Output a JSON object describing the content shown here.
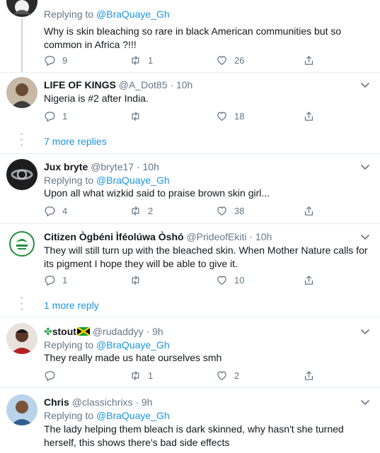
{
  "tweets": [
    {
      "name": "",
      "handle": "",
      "time": "",
      "replying_prefix": "Replying to",
      "replying_to": "@BraQuaye_Gh",
      "text": "Why is skin bleaching so rare in black American communities but so common in Africa ?!!!",
      "replies": "9",
      "retweets": "1",
      "likes": "26"
    },
    {
      "name": "LIFE OF KINGS",
      "handle": "@A_Dot85",
      "time": "10h",
      "text": "Nigeria is #2 after India.",
      "replies": "1",
      "retweets": "",
      "likes": "18"
    },
    {
      "name": "Jux bryte",
      "handle": "@bryte17",
      "time": "10h",
      "replying_prefix": "Replying to",
      "replying_to": "@BraQuaye_Gh",
      "text": "Upon all what wizkid said to praise brown skin girl...",
      "replies": "4",
      "retweets": "2",
      "likes": "38"
    },
    {
      "name": "Citizen Ògbéni Ìféolúwa Òshó",
      "handle": "@PrideofEkiti",
      "time": "10h",
      "text": "They will still turn up with the bleached skin. When Mother Nature calls for its pigment I hope they will be able to give it.",
      "replies": "1",
      "retweets": "",
      "likes": "10"
    },
    {
      "name_prefix": "✤",
      "name": "stout",
      "handle": "@rudaddyy",
      "time": "9h",
      "replying_prefix": "Replying to",
      "replying_to": "@BraQuaye_Gh",
      "text": "They really made us hate ourselves smh",
      "replies": "",
      "retweets": "1",
      "likes": "2"
    },
    {
      "name": "Chris",
      "handle": "@classichrixs",
      "time": "9h",
      "replying_prefix": "Replying to",
      "replying_to": "@BraQuaye_Gh",
      "text": "The lady helping them bleach is dark skinned, why hasn't she turned herself, this shows there's bad side effects"
    }
  ],
  "more_replies_1": "7 more replies",
  "more_replies_2": "1 more reply",
  "separator_dot": "·",
  "icons": {
    "reply": "reply-icon",
    "retweet": "retweet-icon",
    "like": "heart-icon",
    "share": "share-icon",
    "menu": "chevron-down-icon"
  },
  "colors": {
    "link": "#1b95e0",
    "muted": "#657786",
    "divider": "#e6ecf0",
    "thread_line": "#ccd6dd"
  }
}
